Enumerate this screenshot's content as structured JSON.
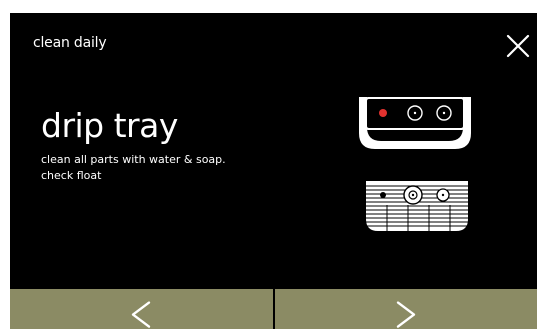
{
  "header": {
    "title": "clean daily",
    "close_icon": "close-icon"
  },
  "content": {
    "heading": "drip tray",
    "instructions": [
      "clean all parts with water & soap.",
      "check float"
    ]
  },
  "illustration": {
    "icon": "drip-tray-illustration",
    "float_indicator_color": "#e2322f"
  },
  "nav": {
    "prev_icon": "chevron-left-icon",
    "next_icon": "chevron-right-icon"
  },
  "colors": {
    "screen_background": "#000000",
    "nav_button": "#8b8b64",
    "text": "#ffffff"
  }
}
